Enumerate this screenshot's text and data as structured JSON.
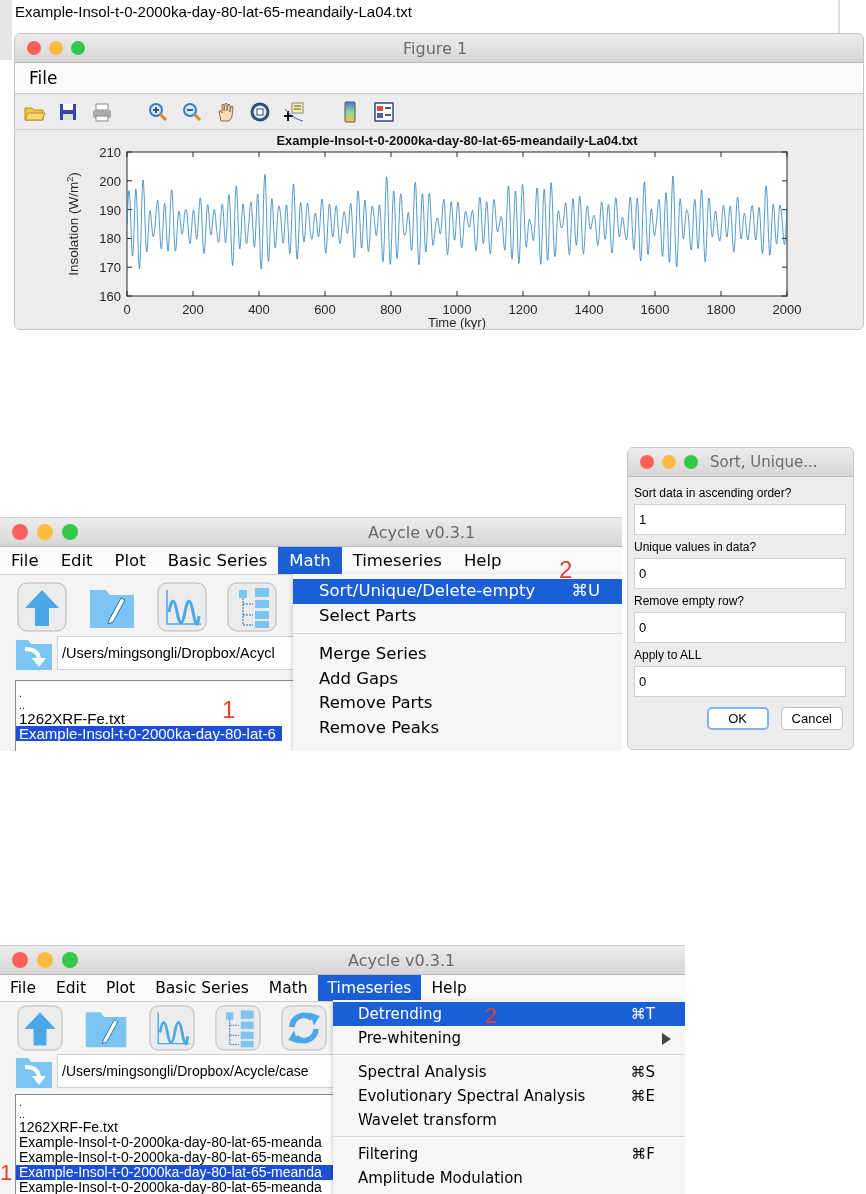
{
  "background_list": {
    "items": [
      "Example-Insol-t-0-2000ka-day-80-lat-65-meandaily-La04.txt"
    ]
  },
  "figure_window": {
    "title": "Figure 1",
    "menu": [
      {
        "label": "File"
      }
    ],
    "toolbar": [
      {
        "kind": "open"
      },
      {
        "kind": "save"
      },
      {
        "kind": "print"
      },
      {
        "kind": "gap"
      },
      {
        "kind": "zoom-in"
      },
      {
        "kind": "zoom-out"
      },
      {
        "kind": "pan"
      },
      {
        "kind": "rotate"
      },
      {
        "kind": "cursor"
      },
      {
        "kind": "gap"
      },
      {
        "kind": "colorbar"
      },
      {
        "kind": "legend"
      }
    ],
    "plot": {
      "title": "Example-Insol-t-0-2000ka-day-80-lat-65-meandaily-La04.txt",
      "xlabel": "Time (kyr)",
      "ylabel": "Insolation (W/m$^{2}$)",
      "xticks": [
        "0",
        "200",
        "400",
        "600",
        "800",
        "1000",
        "1200",
        "1400",
        "1600",
        "1800",
        "2000"
      ],
      "yticks": [
        "210",
        "200",
        "190",
        "180",
        "170",
        "160"
      ]
    }
  },
  "math_screen": {
    "window": {
      "title": "Acycle v0.3.1",
      "menu": [
        {
          "label": "File",
          "selected": false
        },
        {
          "label": "Edit",
          "selected": false
        },
        {
          "label": "Plot",
          "selected": false
        },
        {
          "label": "Basic Series",
          "selected": false
        },
        {
          "label": "Math",
          "selected": true
        },
        {
          "label": "Timeseries",
          "selected": false
        },
        {
          "label": "Help",
          "selected": false
        }
      ],
      "toolbar": [
        {
          "kind": "up"
        },
        {
          "kind": "edit-folder"
        },
        {
          "kind": "wave"
        },
        {
          "kind": "tree"
        }
      ],
      "path": "/Users/mingsongli/Dropbox/Acycl",
      "files": [
        {
          "name": ".",
          "kind": "dir",
          "selected": false
        },
        {
          "name": "..",
          "kind": "dir",
          "selected": false
        },
        {
          "name": "1262XRF-Fe.txt",
          "kind": "file",
          "selected": false
        },
        {
          "name": "Example-Insol-t-0-2000ka-day-80-lat-6",
          "kind": "file",
          "selected": true
        }
      ],
      "list_marker": "1",
      "dropdown": {
        "marker": "2",
        "items": [
          {
            "kind": "item",
            "label": "Sort/Unique/Delete-empty",
            "shortcut": "⌘U",
            "selected": true
          },
          {
            "kind": "item",
            "label": "Select Parts",
            "selected": false
          },
          {
            "kind": "separator"
          },
          {
            "kind": "item",
            "label": "Merge Series",
            "selected": false
          },
          {
            "kind": "item",
            "label": "Add Gaps",
            "selected": false
          },
          {
            "kind": "item",
            "label": "Remove Parts",
            "selected": false
          },
          {
            "kind": "item",
            "label": "Remove Peaks",
            "selected": false
          }
        ]
      }
    },
    "dialog": {
      "title": "Sort, Unique...",
      "fields": [
        {
          "label": "Sort data in ascending order?",
          "value": "1"
        },
        {
          "label": "Unique values in data?",
          "value": "0"
        },
        {
          "label": "Remove empty row?",
          "value": "0"
        },
        {
          "label": "Apply to ALL",
          "value": "0"
        }
      ],
      "buttons": [
        {
          "label": "OK",
          "default": true
        },
        {
          "label": "Cancel",
          "default": false
        }
      ]
    }
  },
  "timeseries_screen": {
    "window": {
      "title": "Acycle v0.3.1",
      "menu": [
        {
          "label": "File",
          "selected": false
        },
        {
          "label": "Edit",
          "selected": false
        },
        {
          "label": "Plot",
          "selected": false
        },
        {
          "label": "Basic Series",
          "selected": false
        },
        {
          "label": "Math",
          "selected": false
        },
        {
          "label": "Timeseries",
          "selected": true
        },
        {
          "label": "Help",
          "selected": false
        }
      ],
      "toolbar": [
        {
          "kind": "up"
        },
        {
          "kind": "edit-folder"
        },
        {
          "kind": "wave"
        },
        {
          "kind": "tree"
        },
        {
          "kind": "refresh"
        }
      ],
      "path": "/Users/mingsongli/Dropbox/Acycle/case",
      "files": [
        {
          "name": ".",
          "kind": "dir",
          "selected": false
        },
        {
          "name": "..",
          "kind": "dir",
          "selected": false
        },
        {
          "name": "1262XRF-Fe.txt",
          "kind": "file",
          "selected": false
        },
        {
          "name": "Example-Insol-t-0-2000ka-day-80-lat-65-meanda",
          "kind": "file",
          "selected": false
        },
        {
          "name": "Example-Insol-t-0-2000ka-day-80-lat-65-meanda",
          "kind": "file",
          "selected": false
        },
        {
          "name": "Example-Insol-t-0-2000ka-day-80-lat-65-meanda",
          "kind": "file",
          "selected": true
        },
        {
          "name": "Example-Insol-t-0-2000ka-day-80-lat-65-meanda",
          "kind": "file",
          "selected": false
        }
      ],
      "list_marker": "1",
      "dropdown": {
        "marker": "2",
        "items": [
          {
            "kind": "item",
            "label": "Detrending",
            "shortcut": "⌘T",
            "selected": true
          },
          {
            "kind": "submenu",
            "label": "Pre-whitening",
            "selected": false
          },
          {
            "kind": "separator"
          },
          {
            "kind": "item",
            "label": "Spectral Analysis",
            "shortcut": "⌘S",
            "selected": false
          },
          {
            "kind": "item",
            "label": "Evolutionary Spectral Analysis",
            "shortcut": "⌘E",
            "selected": false
          },
          {
            "kind": "item",
            "label": "Wavelet transform",
            "selected": false
          },
          {
            "kind": "separator"
          },
          {
            "kind": "item",
            "label": "Filtering",
            "shortcut": "⌘F",
            "selected": false
          },
          {
            "kind": "item",
            "label": "Amplitude Modulation",
            "selected": false
          }
        ]
      }
    }
  }
}
